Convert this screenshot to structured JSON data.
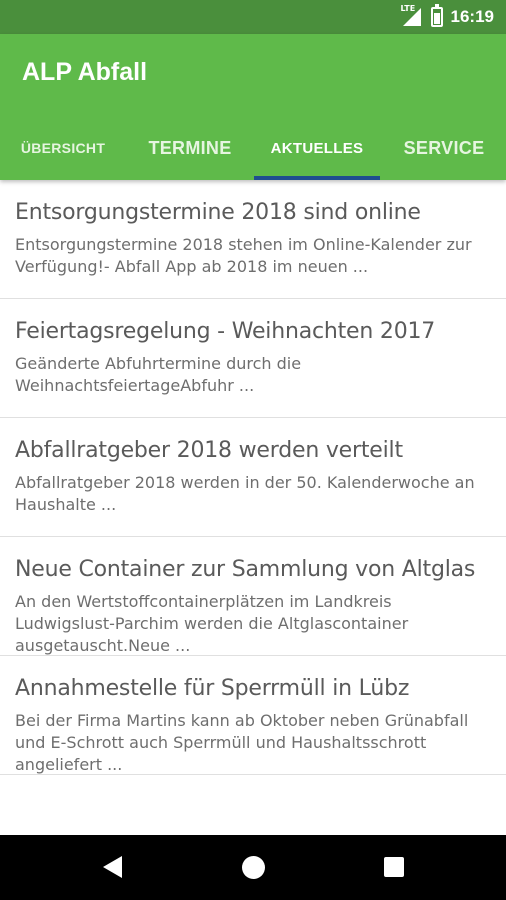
{
  "status_bar": {
    "network_label": "LTE",
    "time": "16:19",
    "icons": [
      "signal-icon",
      "battery-icon"
    ]
  },
  "app": {
    "title": "ALP Abfall",
    "colors": {
      "app_bar": "#5fba4a",
      "status_bar": "#4a8f3c",
      "tab_indicator": "#1f4e8f"
    }
  },
  "tabs": [
    {
      "label": "Übersicht",
      "selected": false
    },
    {
      "label": "Termine",
      "selected": false
    },
    {
      "label": "Aktuelles",
      "selected": true
    },
    {
      "label": "Service",
      "selected": false
    }
  ],
  "news": [
    {
      "title": "Entsorgungstermine 2018 sind online",
      "snippet": "Entsorgungstermine 2018 stehen im Online-Kalender zur Verfügung!- Abfall App ab 2018 im neuen ..."
    },
    {
      "title": "Feiertagsregelung - Weihnachten 2017",
      "snippet": "Geänderte Abfuhrtermine durch die WeihnachtsfeiertageAbfuhr ..."
    },
    {
      "title": "Abfallratgeber 2018 werden verteilt",
      "snippet": "Abfallratgeber 2018 werden in der 50. Kalenderwoche an Haushalte ..."
    },
    {
      "title": "Neue Container zur Sammlung von Altglas",
      "snippet": "An den Wertstoffcontainerplätzen im Landkreis Ludwigslust-Parchim werden die Altglascontainer ausgetauscht.Neue ..."
    },
    {
      "title": "Annahmestelle für Sperrmüll in Lübz",
      "snippet": "Bei der Firma Martins kann ab Oktober neben Grünabfall und E-Schrott auch Sperrmüll und Haushaltsschrott angeliefert ..."
    }
  ],
  "nav_bar": {
    "buttons": [
      "back-icon",
      "home-icon",
      "recent-apps-icon"
    ]
  }
}
